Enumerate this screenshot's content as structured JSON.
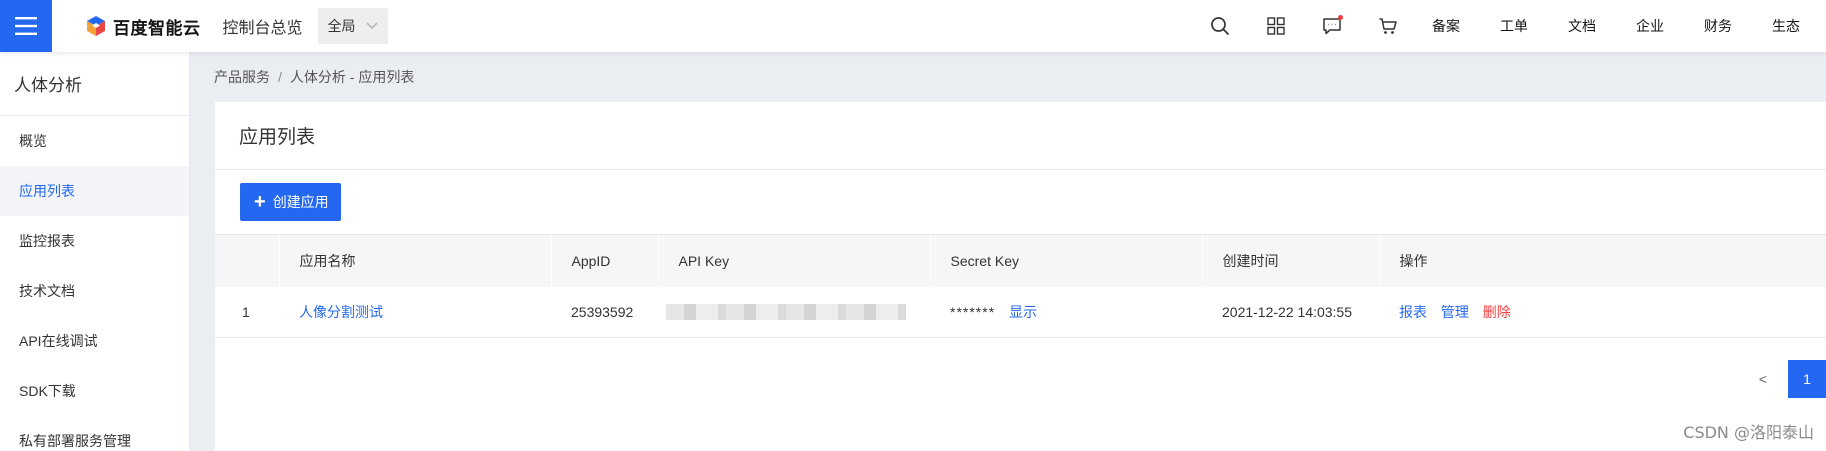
{
  "header": {
    "brand": "百度智能云",
    "console_title": "控制台总览",
    "region": "全局",
    "links": [
      "备案",
      "工单",
      "文档",
      "企业",
      "财务",
      "生态"
    ]
  },
  "sidebar": {
    "title": "人体分析",
    "items": [
      {
        "label": "概览",
        "active": false
      },
      {
        "label": "应用列表",
        "active": true
      },
      {
        "label": "监控报表",
        "active": false
      },
      {
        "label": "技术文档",
        "active": false
      },
      {
        "label": "API在线调试",
        "active": false
      },
      {
        "label": "SDK下载",
        "active": false
      },
      {
        "label": "私有部署服务管理",
        "active": false
      }
    ]
  },
  "breadcrumb": {
    "root": "产品服务",
    "separator": "/",
    "current": "人体分析 - 应用列表"
  },
  "page": {
    "title": "应用列表",
    "create_button": "创建应用"
  },
  "table": {
    "columns": [
      "",
      "应用名称",
      "AppID",
      "API Key",
      "Secret Key",
      "创建时间",
      "操作"
    ],
    "rows": [
      {
        "index": "1",
        "name": "人像分割测试",
        "app_id": "25393592",
        "secret_masked": "*******",
        "secret_show": "显示",
        "created": "2021-12-22 14:03:55",
        "actions": {
          "report": "报表",
          "manage": "管理",
          "delete": "删除"
        }
      }
    ]
  },
  "pagination": {
    "prev": "<",
    "current": "1"
  },
  "watermark": "CSDN @洛阳泰山",
  "colors": {
    "accent": "#2468f2",
    "danger": "#f33e3e",
    "content_bg": "#eaedf1"
  }
}
